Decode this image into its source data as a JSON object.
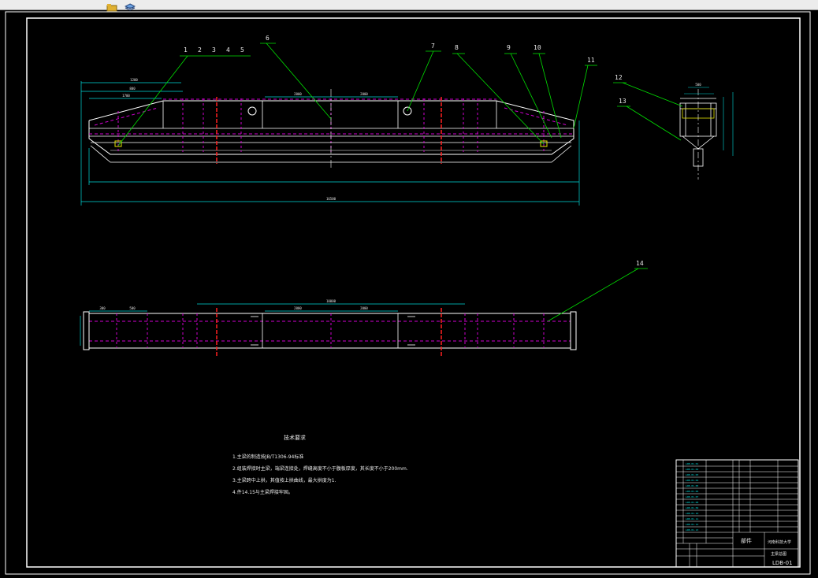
{
  "toolbar": {
    "icons": [
      "folder-icon",
      "layers-icon"
    ]
  },
  "colors": {
    "background": "#000000",
    "frame": "#ffffff",
    "outline": "#ffffff",
    "hidden_lines": "#d000d0",
    "dimension": "#00d8d8",
    "leader": "#00e000",
    "section": "#ff2020",
    "text": "#e8e8e8",
    "yellow": "#e0e000"
  },
  "balloons": [
    "1",
    "2",
    "3",
    "4",
    "5",
    "6",
    "7",
    "8",
    "9",
    "10",
    "11",
    "12",
    "13",
    "14"
  ],
  "technical_requirements": {
    "title": "技术要求",
    "items": [
      "1.主梁的制造按JB/T1306-94标准",
      "2.组装焊接时主梁，端梁连接处，焊缝高度不小于腹板厚度，其长度不小于200mm.",
      "3.主梁跨中上拱，其值按上拱曲线，最大拱度为1.",
      "4.件14.15与主梁焊接牢固。"
    ]
  },
  "title_block": {
    "drawing_name": "主梁总图",
    "drawing_number": "LDB-01",
    "designer_school": "河南科技大学",
    "assembly_label": "部件"
  }
}
